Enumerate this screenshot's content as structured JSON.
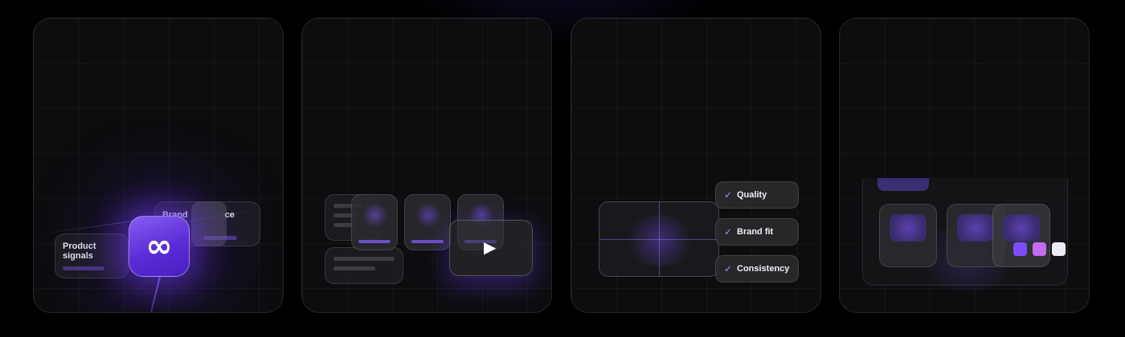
{
  "panel_brand": {
    "card_product_signals": "Product\nsignals",
    "card_brand_guidance": "Brand               ce",
    "hub_icon": "infinity-icon",
    "hub_glyph": "∞"
  },
  "panel_media": {
    "play_icon": "play-icon",
    "play_glyph": "▶"
  },
  "panel_checks": {
    "check_glyph": "✓",
    "items": [
      {
        "label": "Quality"
      },
      {
        "label": "Brand fit"
      },
      {
        "label": "Consistency"
      }
    ]
  },
  "panel_palette": {
    "swatches": [
      "#7c4dff",
      "#c56cf0",
      "#ecebf5"
    ]
  },
  "colors": {
    "accent": "#7c4dff",
    "background": "#000000",
    "panel": "#0d0d0f"
  }
}
